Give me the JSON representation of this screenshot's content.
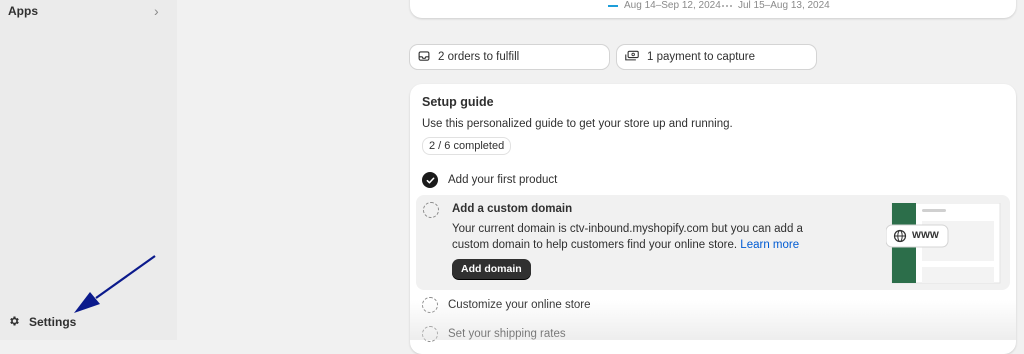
{
  "sidebar": {
    "apps_label": "Apps",
    "settings_label": "Settings"
  },
  "chart_legend": {
    "current_range": "Aug 14–Sep 12, 2024",
    "previous_range": "Jul 15–Aug 13, 2024"
  },
  "actions": {
    "orders": "2 orders to fulfill",
    "payments": "1 payment to capture"
  },
  "setup_guide": {
    "title": "Setup guide",
    "description": "Use this personalized guide to get your store up and running.",
    "progress": "2 / 6 completed",
    "tasks": [
      {
        "label": "Add your first product",
        "done": true
      },
      {
        "label": "Add a custom domain",
        "description": "Your current domain is ctv-inbound.myshopify.com but you can add a custom domain to help customers find your online store.",
        "link": "Learn more",
        "button": "Add domain",
        "illustration_text": "WWW"
      },
      {
        "label": "Customize your online store",
        "done": false
      },
      {
        "label": "Set your shipping rates",
        "done": false
      }
    ]
  },
  "colors": {
    "accent_blue": "#005bd3",
    "chart_line": "#1d9ed9",
    "sidebar_bg": "#ebebeb",
    "page_bg": "#f1f1f1",
    "illustration_green": "#2c6e4a",
    "arrow": "#0b1a8c"
  }
}
